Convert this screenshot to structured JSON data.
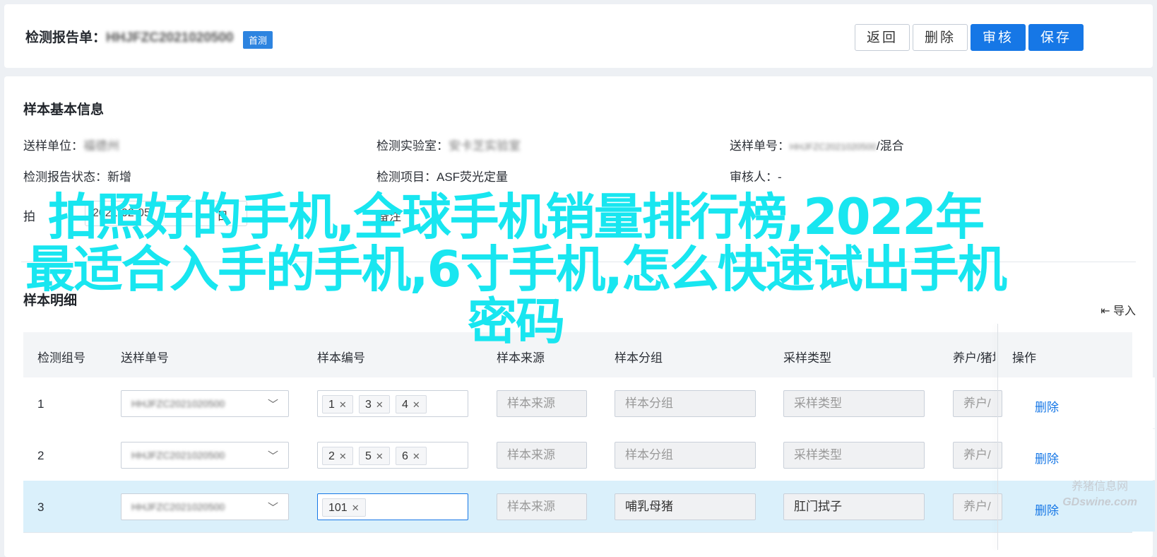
{
  "header": {
    "title_prefix": "检测报告单：",
    "title_value": "HHJFZC2021020500",
    "badge": "首测",
    "buttons": {
      "back": "返回",
      "delete": "删除",
      "review": "审核",
      "save": "保存"
    }
  },
  "basic_info": {
    "title": "样本基本信息",
    "fields": [
      {
        "label": "送样单位：",
        "value": "福德州",
        "blurred": true
      },
      {
        "label": "检测实验室：",
        "value": "安卡芝实验室",
        "blurred": true
      },
      {
        "label": "送样单号：",
        "value": "HHJFZC2021020500",
        "suffix": "/混合",
        "blurred": true
      },
      {
        "label": "检测报告状态：",
        "value": "新增"
      },
      {
        "label": "检测项目：",
        "value": "ASF荧光定量"
      },
      {
        "label": "审核人：",
        "value": "-"
      }
    ],
    "date_label": "拍",
    "date_value": "2021-02-05",
    "date_suffix": "日",
    "remark_label": "备注"
  },
  "detail": {
    "title": "样本明细",
    "import_label": "导入",
    "columns": [
      "检测组号",
      "送样单号",
      "样本编号",
      "样本来源",
      "样本分组",
      "采样类型",
      "养户/猪场",
      "操作"
    ],
    "rows": [
      {
        "no": "1",
        "order": "HHJFZC2021020500",
        "tags": [
          "1",
          "3",
          "4"
        ],
        "source": "样本来源",
        "group": "样本分组",
        "type": "采样类型",
        "farm": "养户/猪场",
        "op": "删除",
        "selected": false
      },
      {
        "no": "2",
        "order": "HHJFZC2021020500",
        "tags": [
          "2",
          "5",
          "6"
        ],
        "source": "样本来源",
        "group": "样本分组",
        "type": "采样类型",
        "farm": "养户/猪场",
        "op": "删除",
        "selected": false
      },
      {
        "no": "3",
        "order": "HHJFZC2021020500",
        "tags": [
          "101"
        ],
        "source": "样本来源",
        "group": "哺乳母猪",
        "type": "肛门拭子",
        "farm": "养户/猪场",
        "op": "删除",
        "selected": true
      }
    ]
  },
  "overlay": {
    "line1": "拍照好的手机,全球手机销量排行榜,2022年",
    "line2": "最适合入手的手机,6寸手机,怎么快速试出手机",
    "line3": "密码"
  },
  "watermark": {
    "line1": "养猪信息网",
    "line2": "GDswine.com"
  },
  "colors": {
    "primary": "#1677e6",
    "overlay": "#18e6f0",
    "selected_row": "#daf0fb"
  }
}
